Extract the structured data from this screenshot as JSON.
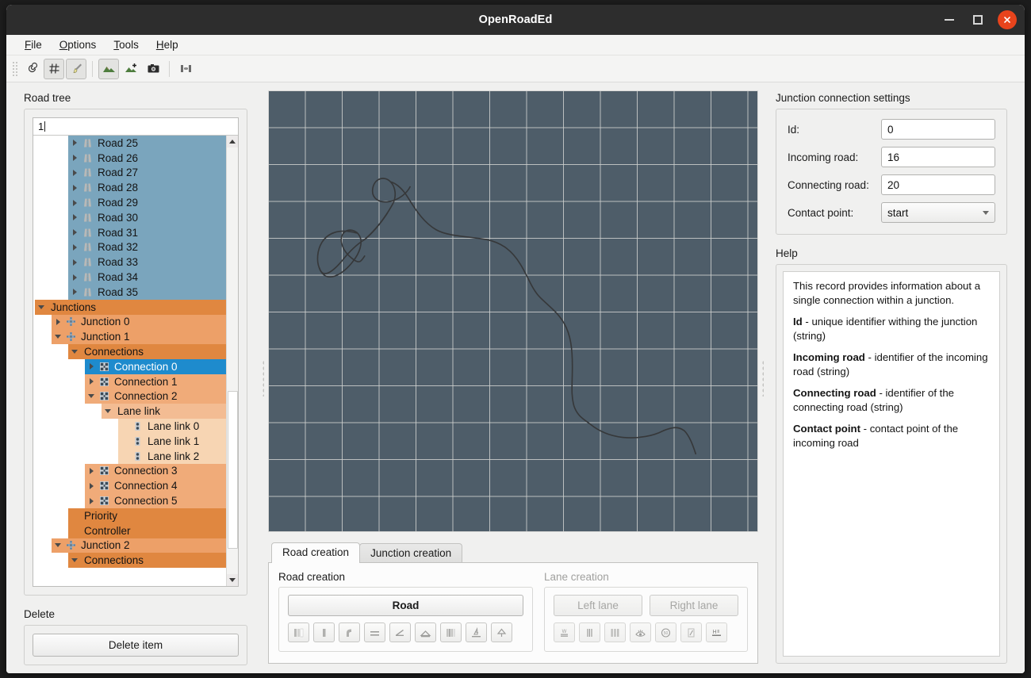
{
  "window": {
    "title": "OpenRoadEd"
  },
  "titlebar": {
    "minimize": "minimize-button",
    "maximize": "maximize-button",
    "close": "close-button"
  },
  "menubar": {
    "items": [
      {
        "mnemonic": "F",
        "rest": "ile"
      },
      {
        "mnemonic": "O",
        "rest": "ptions"
      },
      {
        "mnemonic": "T",
        "rest": "ools"
      },
      {
        "mnemonic": "H",
        "rest": "elp"
      }
    ]
  },
  "toolbar": {
    "buttons": [
      {
        "name": "spiral-tool",
        "checked": false
      },
      {
        "name": "grid-toggle",
        "checked": true
      },
      {
        "name": "brush-tool",
        "checked": true
      },
      {
        "name": "terrain-view",
        "checked": true
      },
      {
        "name": "add-terrain",
        "checked": false
      },
      {
        "name": "camera-snapshot",
        "checked": false
      },
      {
        "name": "panel-toggle",
        "checked": false
      }
    ]
  },
  "left": {
    "tree_label": "Road tree",
    "filter_value": "1",
    "delete_label": "Delete",
    "delete_button": "Delete item",
    "tree_rows": [
      {
        "label": "Road 25",
        "depth": 2,
        "twist": "closed",
        "icon": "road-icon",
        "bg": "blue"
      },
      {
        "label": "Road 26",
        "depth": 2,
        "twist": "closed",
        "icon": "road-icon",
        "bg": "blue"
      },
      {
        "label": "Road 27",
        "depth": 2,
        "twist": "closed",
        "icon": "road-icon",
        "bg": "blue"
      },
      {
        "label": "Road 28",
        "depth": 2,
        "twist": "closed",
        "icon": "road-icon",
        "bg": "blue"
      },
      {
        "label": "Road 29",
        "depth": 2,
        "twist": "closed",
        "icon": "road-icon",
        "bg": "blue"
      },
      {
        "label": "Road 30",
        "depth": 2,
        "twist": "closed",
        "icon": "road-icon",
        "bg": "blue"
      },
      {
        "label": "Road 31",
        "depth": 2,
        "twist": "closed",
        "icon": "road-icon",
        "bg": "blue"
      },
      {
        "label": "Road 32",
        "depth": 2,
        "twist": "closed",
        "icon": "road-icon",
        "bg": "blue"
      },
      {
        "label": "Road 33",
        "depth": 2,
        "twist": "closed",
        "icon": "road-icon",
        "bg": "blue"
      },
      {
        "label": "Road 34",
        "depth": 2,
        "twist": "closed",
        "icon": "road-icon",
        "bg": "blue"
      },
      {
        "label": "Road 35",
        "depth": 2,
        "twist": "closed",
        "icon": "road-icon",
        "bg": "blue"
      },
      {
        "label": "Junctions",
        "depth": 0,
        "twist": "open",
        "icon": "none",
        "bg": "orange-dark"
      },
      {
        "label": "Junction 0",
        "depth": 1,
        "twist": "closed",
        "icon": "junction-icon",
        "bg": "orange"
      },
      {
        "label": "Junction 1",
        "depth": 1,
        "twist": "open",
        "icon": "junction-icon",
        "bg": "orange"
      },
      {
        "label": "Connections",
        "depth": 2,
        "twist": "open",
        "icon": "none",
        "bg": "orange-dark"
      },
      {
        "label": "Connection 0",
        "depth": 3,
        "twist": "closed",
        "icon": "connection-icon",
        "bg": "selected"
      },
      {
        "label": "Connection 1",
        "depth": 3,
        "twist": "closed",
        "icon": "connection-icon",
        "bg": "orange-mid"
      },
      {
        "label": "Connection 2",
        "depth": 3,
        "twist": "open",
        "icon": "connection-icon",
        "bg": "orange-mid"
      },
      {
        "label": "Lane link",
        "depth": 4,
        "twist": "open",
        "icon": "none",
        "bg": "orange-light"
      },
      {
        "label": "Lane link 0",
        "depth": 5,
        "twist": "none",
        "icon": "lanelink-icon",
        "bg": "orange-pale"
      },
      {
        "label": "Lane link 1",
        "depth": 5,
        "twist": "none",
        "icon": "lanelink-icon",
        "bg": "orange-pale"
      },
      {
        "label": "Lane link 2",
        "depth": 5,
        "twist": "none",
        "icon": "lanelink-icon",
        "bg": "orange-pale"
      },
      {
        "label": "Connection 3",
        "depth": 3,
        "twist": "closed",
        "icon": "connection-icon",
        "bg": "orange-mid"
      },
      {
        "label": "Connection 4",
        "depth": 3,
        "twist": "closed",
        "icon": "connection-icon",
        "bg": "orange-mid"
      },
      {
        "label": "Connection 5",
        "depth": 3,
        "twist": "closed",
        "icon": "connection-icon",
        "bg": "orange-mid"
      },
      {
        "label": "Priority",
        "depth": 2,
        "twist": "none",
        "icon": "none",
        "bg": "orange-dark"
      },
      {
        "label": "Controller",
        "depth": 2,
        "twist": "none",
        "icon": "none",
        "bg": "orange-dark"
      },
      {
        "label": "Junction 2",
        "depth": 1,
        "twist": "open",
        "icon": "junction-icon",
        "bg": "orange"
      },
      {
        "label": "Connections",
        "depth": 2,
        "twist": "open",
        "icon": "none",
        "bg": "orange-dark"
      }
    ]
  },
  "center": {
    "tabs": [
      {
        "label": "Road creation",
        "active": true
      },
      {
        "label": "Junction creation",
        "active": false
      }
    ],
    "road_creation": {
      "title": "Road creation",
      "main_button": "Road",
      "icons": [
        "road-segment-icon",
        "line-geometry-icon",
        "arc-geometry-icon",
        "elevation-icon",
        "slope-icon",
        "crossfall-icon",
        "lane-section-icon",
        "signal-icon",
        "object-icon"
      ]
    },
    "lane_creation": {
      "title": "Lane creation",
      "left_button": "Left lane",
      "right_button": "Right lane",
      "disabled": true,
      "icons": [
        "lane-width-icon",
        "road-mark-icon",
        "lane-material-icon",
        "lane-visibility-icon",
        "speed-limit-icon",
        "lane-access-icon",
        "lane-height-icon"
      ]
    }
  },
  "right": {
    "settings_label": "Junction connection settings",
    "fields": [
      {
        "label": "Id:",
        "value": "0",
        "type": "text",
        "name": "id-field"
      },
      {
        "label": "Incoming road:",
        "value": "16",
        "type": "text",
        "name": "incoming-road-field"
      },
      {
        "label": "Connecting road:",
        "value": "20",
        "type": "text",
        "name": "connecting-road-field"
      },
      {
        "label": "Contact point:",
        "value": "start",
        "type": "combo",
        "name": "contact-point-combo"
      }
    ],
    "help_label": "Help",
    "help": {
      "intro": "This record provides information about a single connection within a junction.",
      "entries": [
        {
          "term": "Id",
          "desc": " - unique identifier withing the junction (string)"
        },
        {
          "term": "Incoming road",
          "desc": " - identifier of the incoming road (string)"
        },
        {
          "term": "Connecting road",
          "desc": " - identifier of the connecting road (string)"
        },
        {
          "term": "Contact point",
          "desc": " - contact point of the incoming road"
        }
      ]
    }
  },
  "colors": {
    "accent_blue": "#1e8bcd",
    "tree_blue": "#7aa5bd",
    "orange_dark": "#e08740",
    "orange": "#eda068",
    "orange_mid": "#f0ab79",
    "orange_light": "#f3bc93",
    "orange_pale": "#f7d5b3",
    "canvas_bg": "#4e5d69",
    "close_red": "#e8441c"
  }
}
